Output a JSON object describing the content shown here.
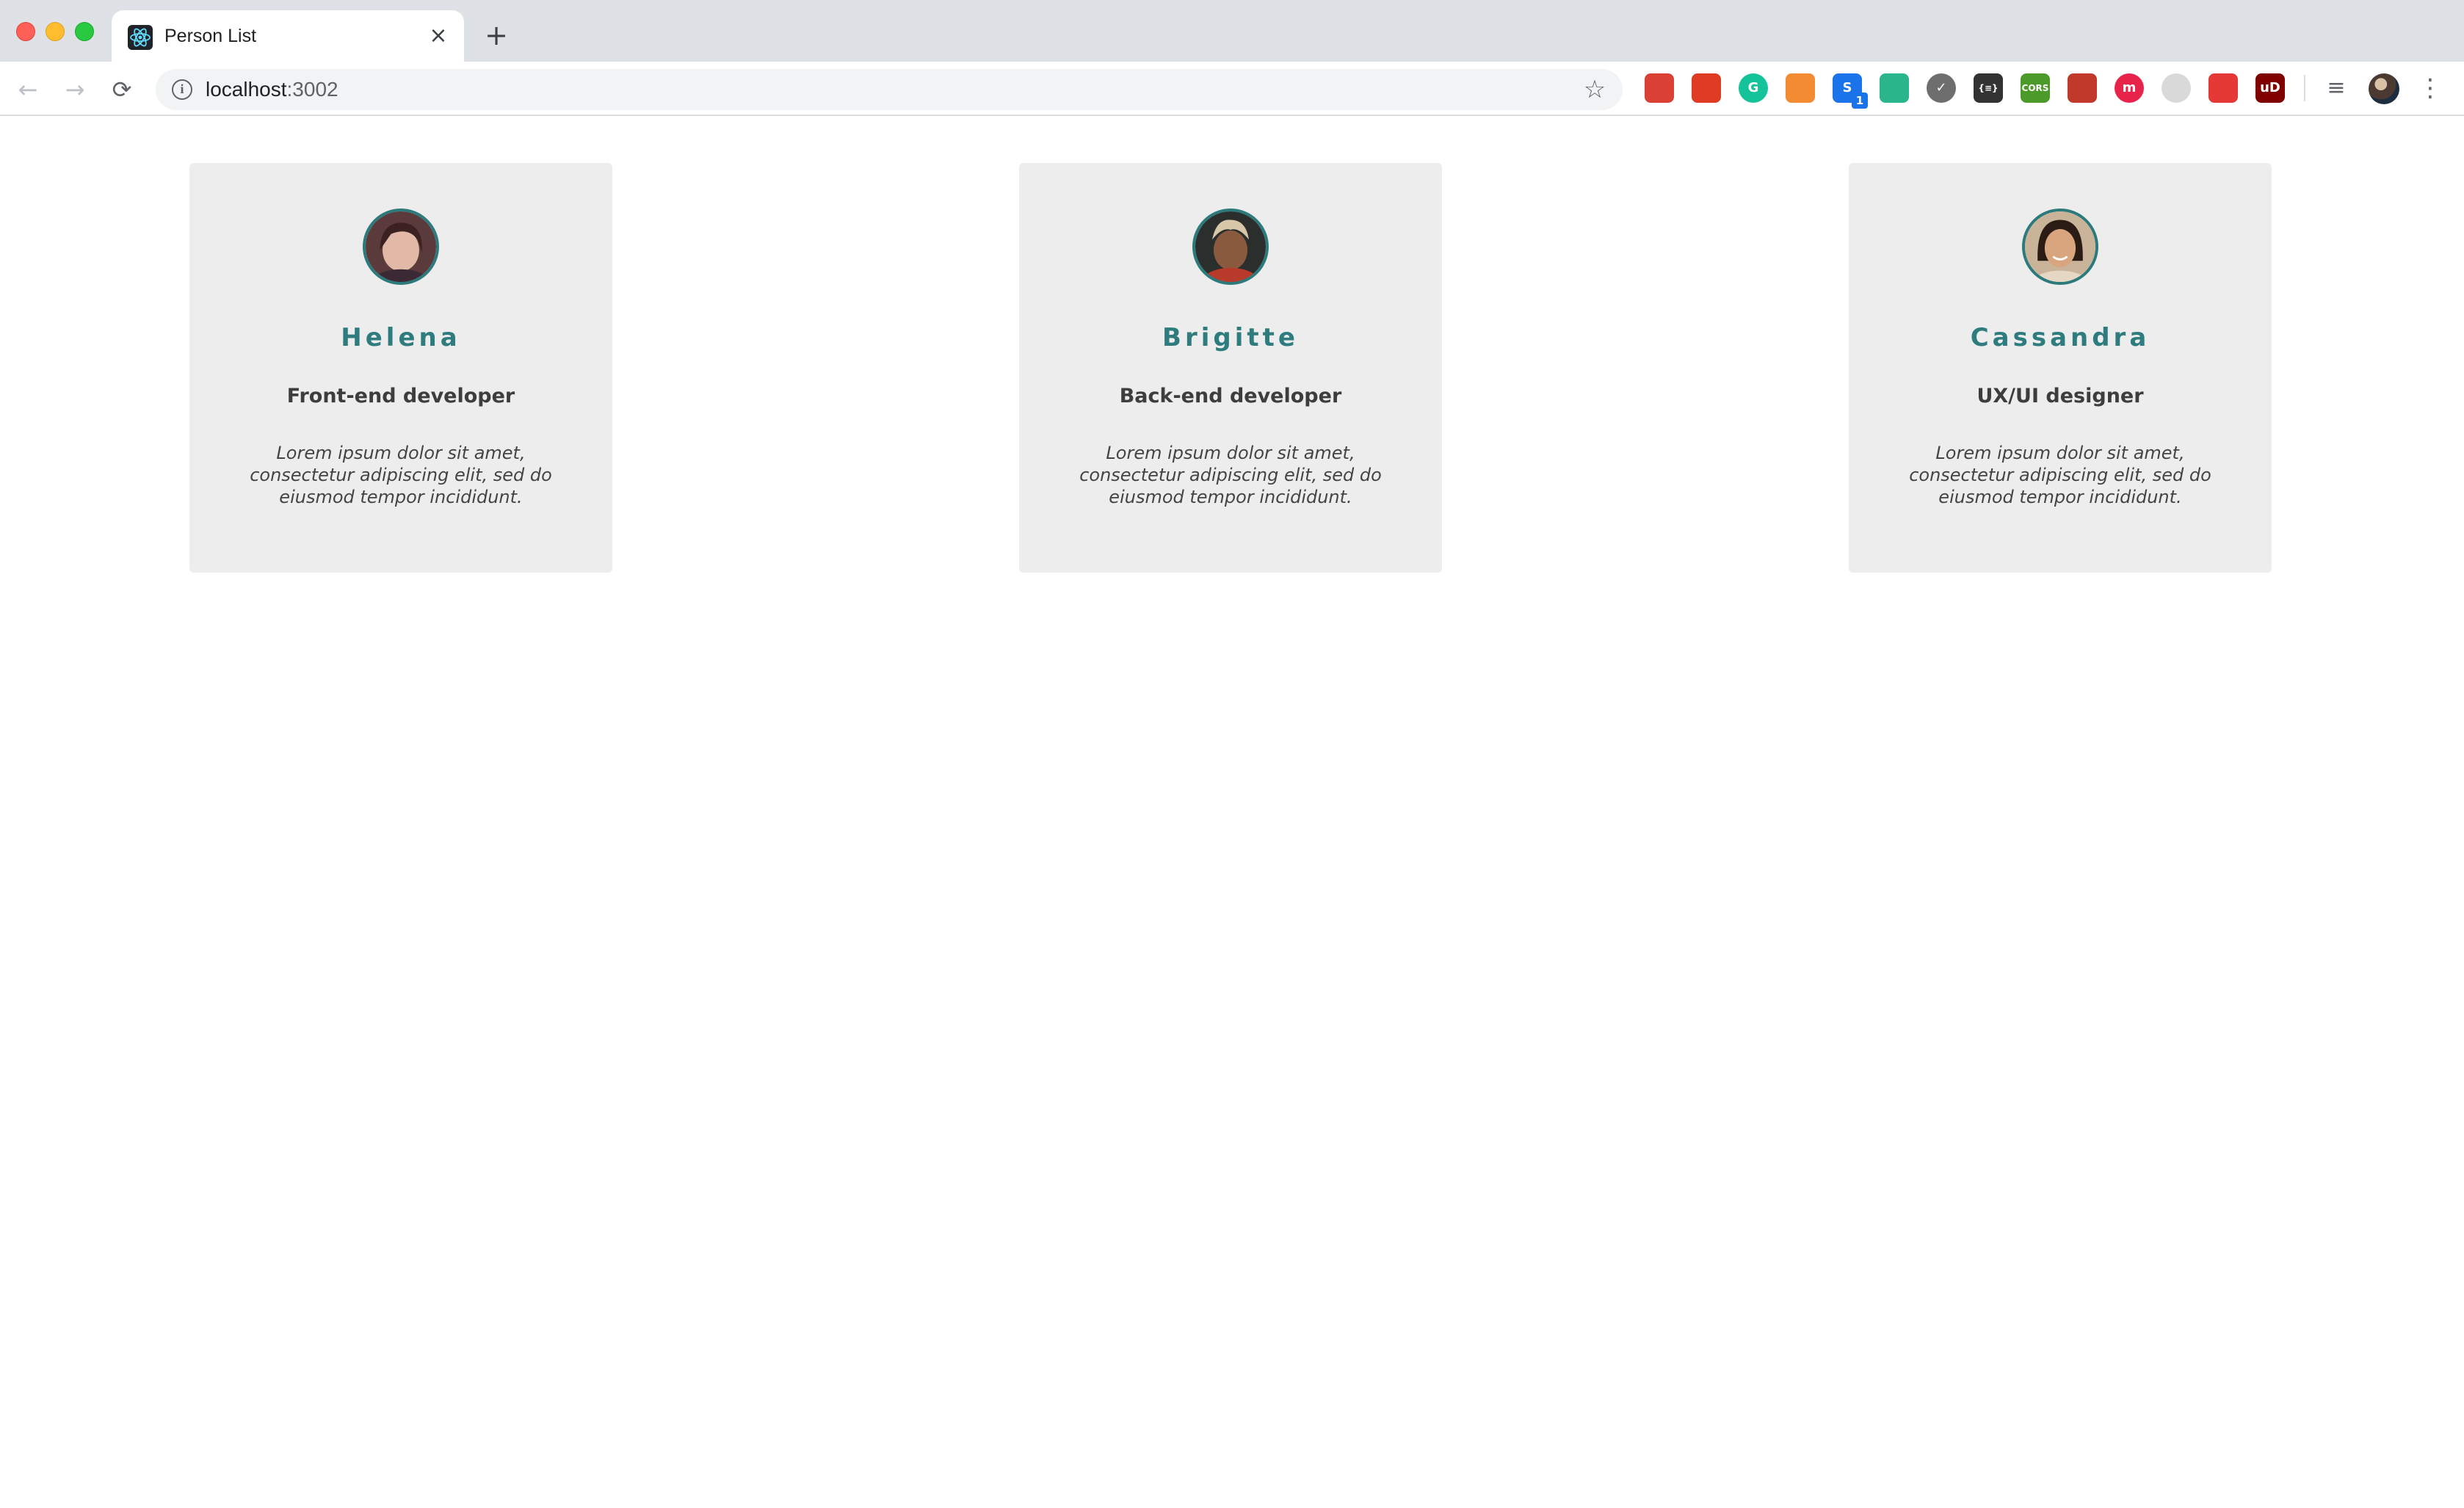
{
  "browser": {
    "tab": {
      "title": "Person List",
      "favicon": "react-icon",
      "close": "×"
    },
    "new_tab": "+",
    "nav": {
      "back": "←",
      "forward": "→",
      "reload": "⟳"
    },
    "address": {
      "host": "localhost",
      "port": ":3002",
      "info_icon": "i"
    },
    "star": "☆",
    "extensions": [
      {
        "name": "todoist-ext-icon",
        "color": "#db4035",
        "label": ""
      },
      {
        "name": "adblock-ext-icon",
        "color": "#e03b25",
        "label": ""
      },
      {
        "name": "grammarly-ext-icon",
        "color": "#15c39a",
        "label": "G"
      },
      {
        "name": "layout-ext-icon",
        "color": "#f28b32",
        "label": ""
      },
      {
        "name": "docs-ext-icon",
        "color": "#1a73e8",
        "label": "S",
        "badge": "1"
      },
      {
        "name": "hummingbird-ext-icon",
        "color": "#2bb58a",
        "label": ""
      },
      {
        "name": "check-ext-icon",
        "color": "#6e6e6e",
        "label": "✓"
      },
      {
        "name": "json-ext-icon",
        "color": "#333333",
        "label": "{≡}"
      },
      {
        "name": "cors-ext-icon",
        "color": "#4c9a2a",
        "label": "CORS"
      },
      {
        "name": "firebug-ext-icon",
        "color": "#c0392b",
        "label": ""
      },
      {
        "name": "mention-ext-icon",
        "color": "#e8234a",
        "label": "m"
      },
      {
        "name": "timer-ext-icon",
        "color": "#d9d9d9",
        "label": ""
      },
      {
        "name": "colorpicker-ext-icon",
        "color": "#e53935",
        "label": ""
      },
      {
        "name": "ublock-ext-icon",
        "color": "#800000",
        "label": "uD"
      }
    ],
    "menu_lines": "≡",
    "kebab": "⋮"
  },
  "people": [
    {
      "name": "Helena",
      "role": "Front-end developer",
      "description": "Lorem ipsum dolor sit amet, consectetur adipiscing elit, sed do eiusmod tempor incididunt."
    },
    {
      "name": "Brigitte",
      "role": "Back-end developer",
      "description": "Lorem ipsum dolor sit amet, consectetur adipiscing elit, sed do eiusmod tempor incididunt."
    },
    {
      "name": "Cassandra",
      "role": "UX/UI designer",
      "description": "Lorem ipsum dolor sit amet, consectetur adipiscing elit, sed do eiusmod tempor incididunt."
    }
  ],
  "colors": {
    "accent": "#2f7c7f",
    "card_bg": "#ededed",
    "avatar_border": "#2c7a7b"
  }
}
